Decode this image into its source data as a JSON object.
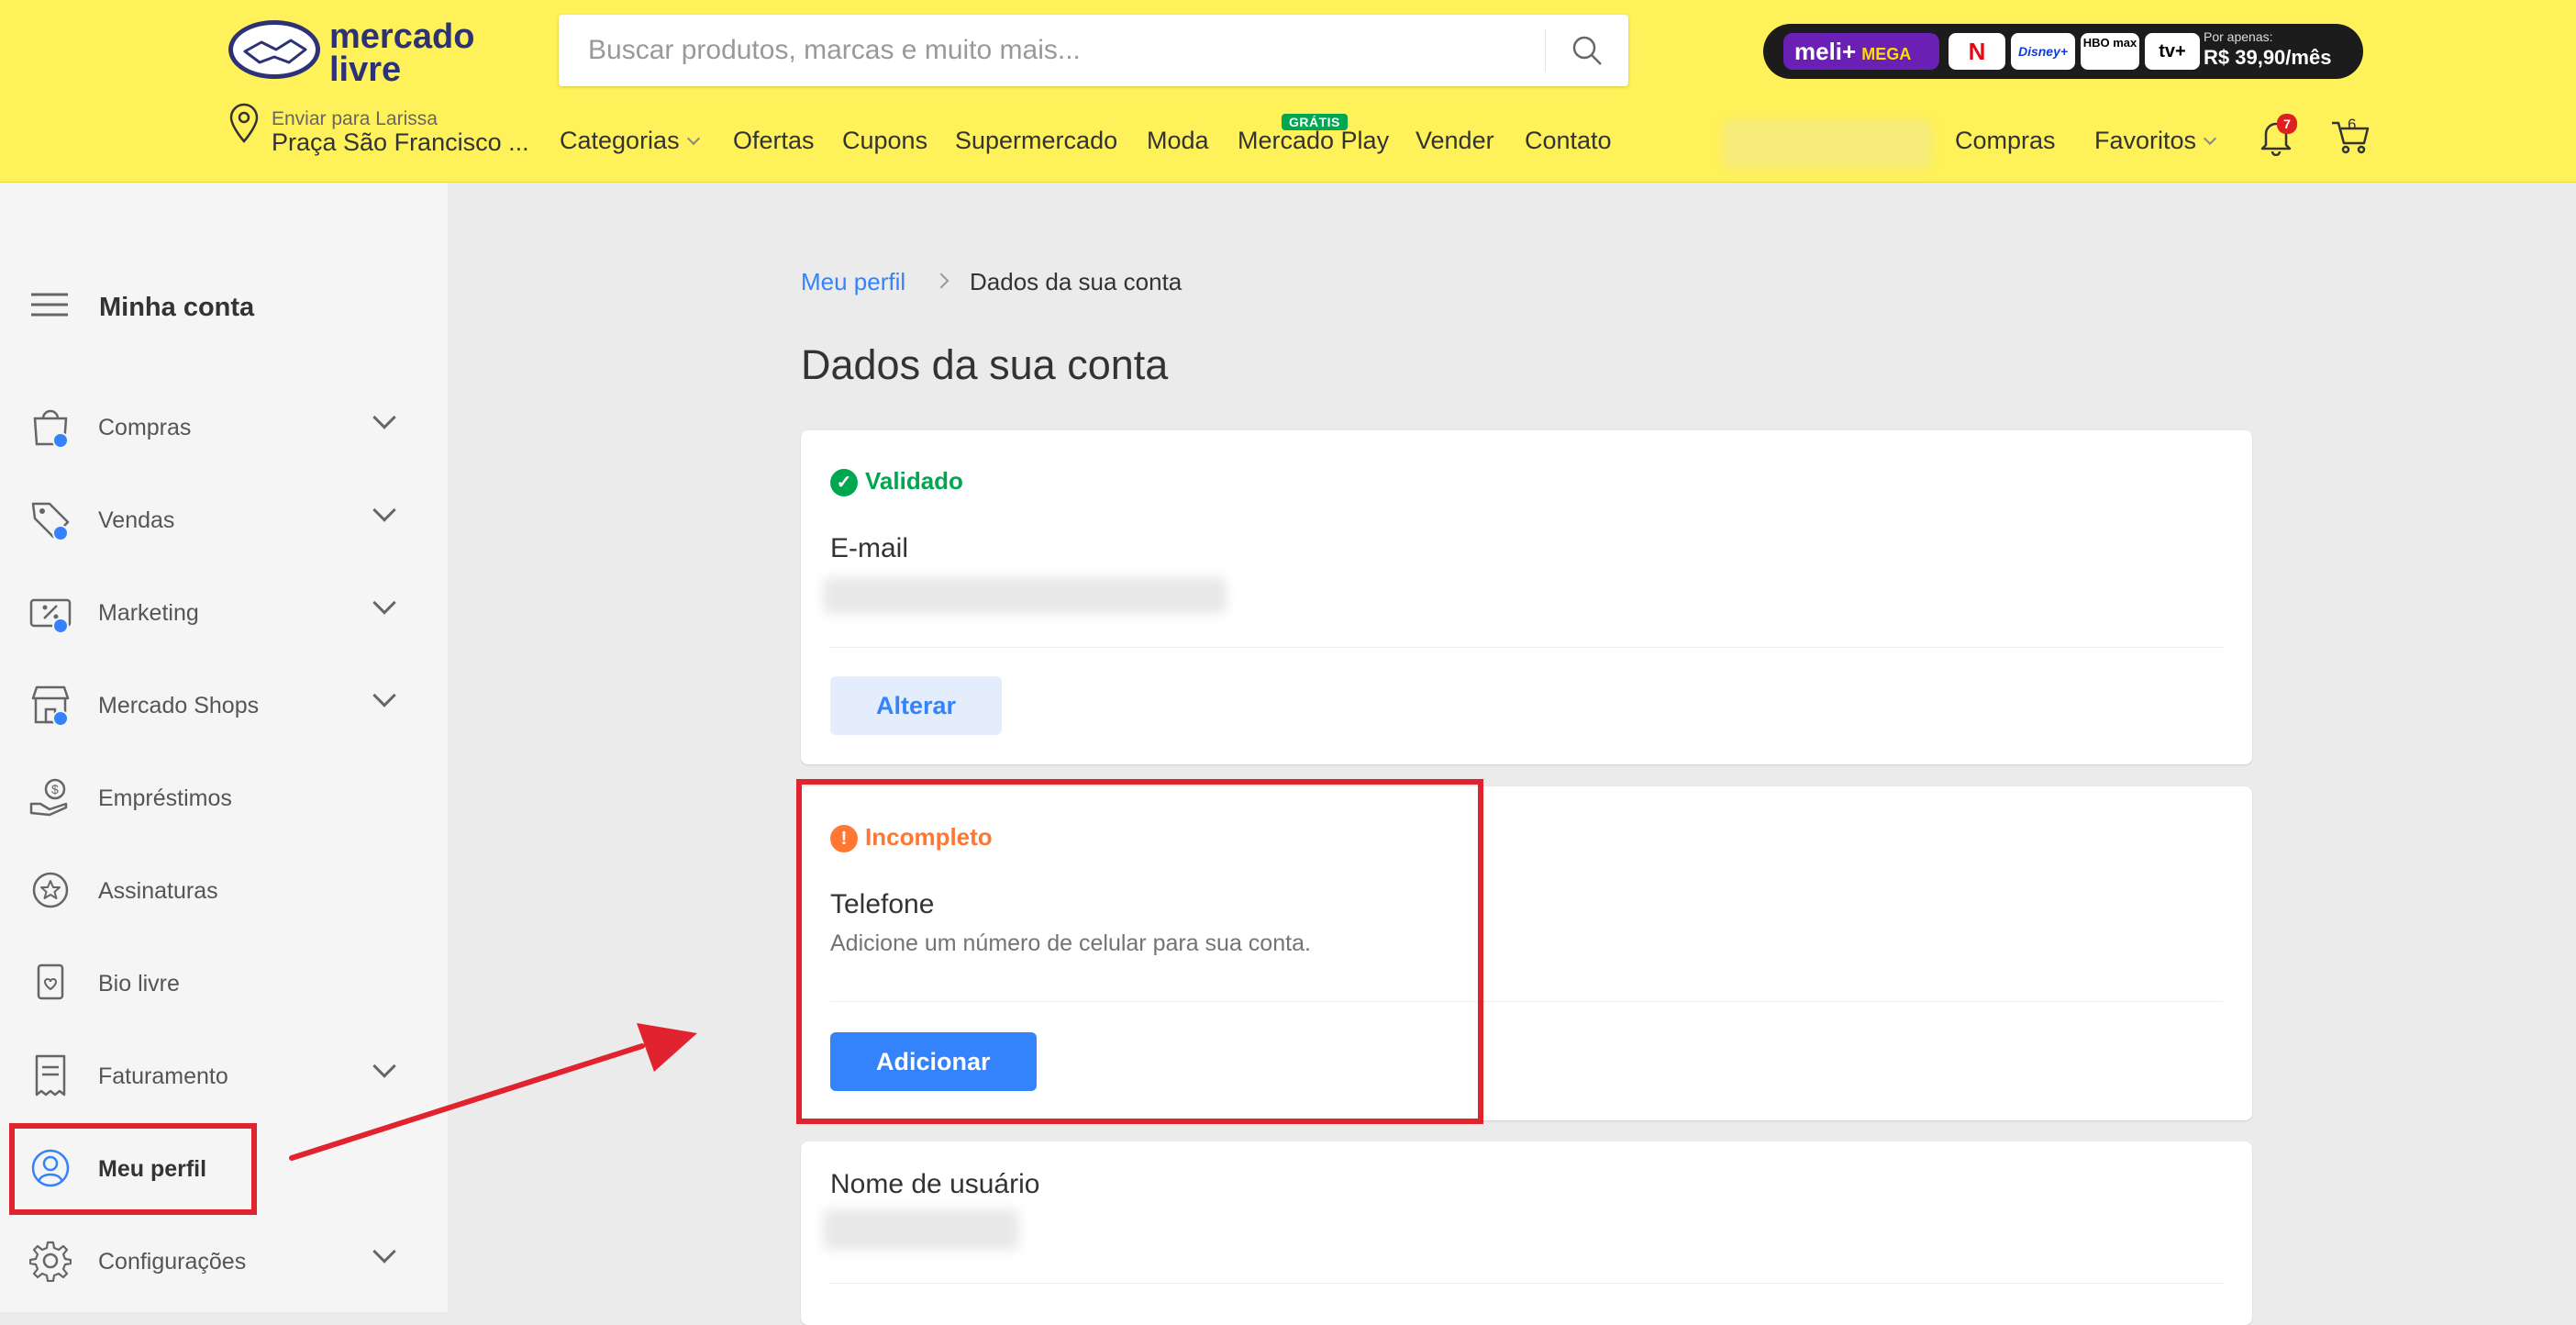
{
  "header": {
    "logo_text": "mercado\nlivre",
    "search": {
      "placeholder": "Buscar produtos, marcas e muito mais..."
    },
    "promo": {
      "brand": "meli+",
      "tier": "MEGA",
      "services": [
        "N",
        "Disney+",
        "HBO max",
        "tv+"
      ],
      "price_prefix": "Por apenas:",
      "price": "R$ 39,90/mês"
    },
    "delivery": {
      "line1": "Enviar para Larissa",
      "line2": "Praça São Francisco ..."
    },
    "nav": [
      {
        "label": "Categorias"
      },
      {
        "label": "Ofertas"
      },
      {
        "label": "Cupons"
      },
      {
        "label": "Supermercado"
      },
      {
        "label": "Moda"
      },
      {
        "label": "Mercado Play"
      },
      {
        "label": "Vender"
      },
      {
        "label": "Contato"
      }
    ],
    "free_badge": "GRÁTIS",
    "right": {
      "purchases": "Compras",
      "favorites": "Favoritos",
      "notifications": "7",
      "cart": "6"
    }
  },
  "sidebar": {
    "title": "Minha conta",
    "items": [
      {
        "label": "Compras"
      },
      {
        "label": "Vendas"
      },
      {
        "label": "Marketing"
      },
      {
        "label": "Mercado Shops"
      },
      {
        "label": "Empréstimos"
      },
      {
        "label": "Assinaturas"
      },
      {
        "label": "Bio livre"
      },
      {
        "label": "Faturamento"
      },
      {
        "label": "Meu perfil"
      },
      {
        "label": "Configurações"
      }
    ]
  },
  "main": {
    "breadcrumb": {
      "parent": "Meu perfil",
      "current": "Dados da sua conta"
    },
    "title": "Dados da sua conta",
    "email_card": {
      "status": "Validado",
      "field": "E-mail",
      "button": "Alterar"
    },
    "phone_card": {
      "status": "Incompleto",
      "field": "Telefone",
      "description": "Adicione um número de celular para sua conta.",
      "button": "Adicionar"
    },
    "username_card": {
      "field": "Nome de usuário"
    }
  },
  "colors": {
    "header_bg": "#fff159",
    "accent": "#3483fa",
    "success": "#00a650",
    "warning": "#ff7733",
    "annotation": "#e0232f"
  }
}
